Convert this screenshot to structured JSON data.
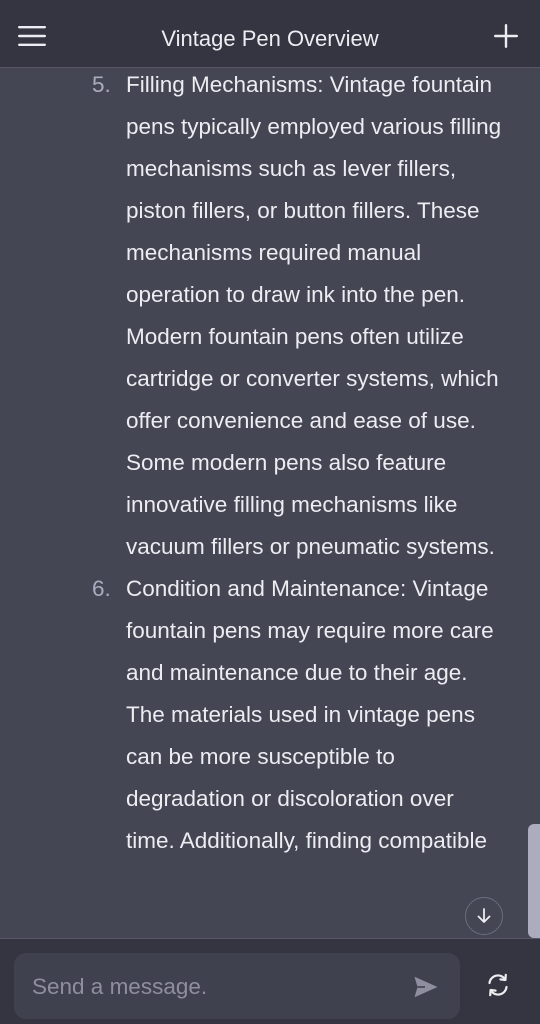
{
  "header": {
    "title": "Vintage Pen Overview",
    "menu_icon": "hamburger-menu-icon",
    "new_chat_icon": "plus-icon"
  },
  "conversation": {
    "items": [
      {
        "number": "5.",
        "text": "Filling Mechanisms: Vintage fountain pens typically employed various filling mechanisms such as lever fillers, piston fillers, or button fillers. These mechanisms required manual operation to draw ink into the pen. Modern fountain pens often utilize cartridge or converter systems, which offer convenience and ease of use. Some modern pens also feature innovative filling mechanisms like vacuum fillers or pneumatic systems."
      },
      {
        "number": "6.",
        "text": "Condition and Maintenance: Vintage fountain pens may require more care and maintenance due to their age. The materials used in vintage pens can be more susceptible to degradation or discoloration over time. Additionally, finding compatible"
      }
    ],
    "scroll_down_icon": "arrow-down-icon"
  },
  "composer": {
    "placeholder": "Send a message.",
    "value": "",
    "send_icon": "send-icon",
    "regenerate_icon": "refresh-icon"
  },
  "colors": {
    "header_bg": "#343541",
    "content_bg": "#444654",
    "input_bg": "#40414f",
    "text": "#ececf1",
    "muted": "#8e8ea0"
  }
}
